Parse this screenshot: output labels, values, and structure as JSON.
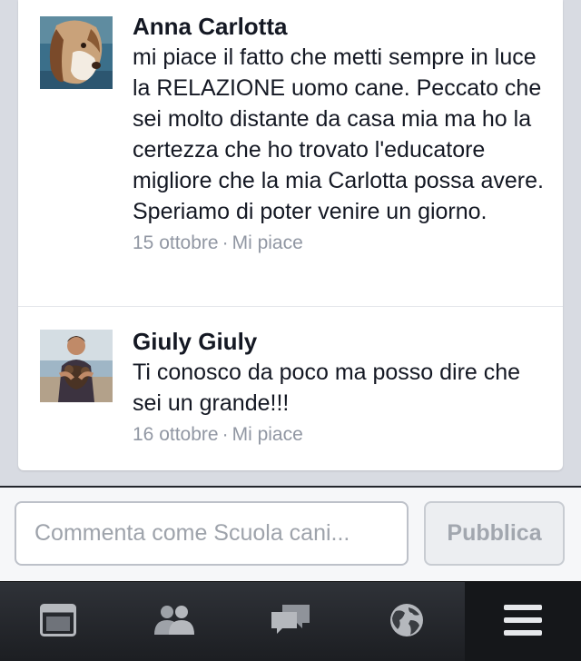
{
  "comments": [
    {
      "author": "Anna Carlotta",
      "text": "mi piace il fatto che metti sempre in luce la RELAZIONE uomo cane. Peccato che sei molto distante da casa mia ma ho la certezza che ho trovato l'educatore migliore che la mia Carlotta possa avere. Speriamo di poter venire un giorno.",
      "date": "15 ottobre",
      "separator": "·",
      "like_label": "Mi piace",
      "avatar_icon": "basset-hound-photo"
    },
    {
      "author": "Giuly Giuly",
      "text": "Ti conosco da poco ma posso dire che sei un grande!!!",
      "date": "16 ottobre",
      "separator": "·",
      "like_label": "Mi piace",
      "avatar_icon": "person-with-dog-photo"
    }
  ],
  "composer": {
    "placeholder": "Commenta come Scuola cani...",
    "publish_label": "Pubblica"
  },
  "tabbar": {
    "items": [
      {
        "icon": "news-feed-icon",
        "active": false
      },
      {
        "icon": "friends-icon",
        "active": false
      },
      {
        "icon": "messages-icon",
        "active": false
      },
      {
        "icon": "globe-icon",
        "active": false
      },
      {
        "icon": "menu-icon",
        "active": true
      }
    ]
  },
  "colors": {
    "background": "#d8dbe2",
    "author_text": "#141823",
    "meta_text": "#9197a3",
    "tabbar": "#1c1e22",
    "tab_icon": "#b5b8bd"
  }
}
